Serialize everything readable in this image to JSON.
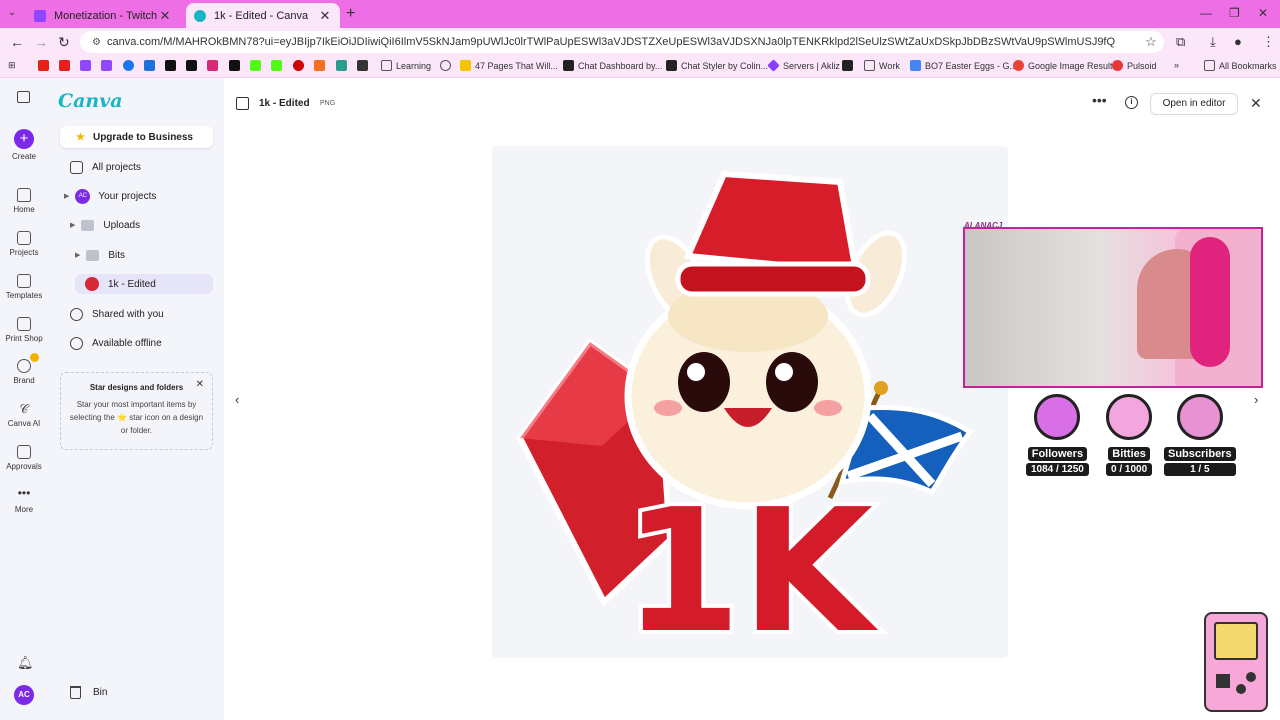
{
  "browser": {
    "tabs": [
      {
        "label": "Monetization - Twitch",
        "close": "✕",
        "icon_color": "#9146ff"
      },
      {
        "label": "1k - Edited - Canva",
        "close": "✕",
        "icon_color": "#17b5c6"
      }
    ],
    "url": "canva.com/M/MAHROkBMN78?ui=eyJBIjp7IkEiOiJDIiwiQiI6IlmV5SkNJam9pUWlJc0lrTWlPaUpESWl3aVJDSTZXeUpESWl3aVJDSXNJa0lpTENKRklpd2lSeUlzSWtZaUxDSkpJbDBzSWtVaU9pSWlmUSJ9fQ",
    "bookmarks": [
      "Learning",
      "47 Pages That Will...",
      "Chat Dashboard by...",
      "Chat Styler by Colin...",
      "Servers | Akliz",
      "Work",
      "BO7 Easter Eggs - G...",
      "Google Image Result",
      "Pulsoid",
      "All Bookmarks"
    ]
  },
  "rail": {
    "create": "Create",
    "home": "Home",
    "projects": "Projects",
    "templates": "Templates",
    "print_shop": "Print Shop",
    "brand": "Brand",
    "canva_ai": "Canva AI",
    "approvals": "Approvals",
    "more": "More",
    "avatar": "AC"
  },
  "panel": {
    "logo": "Canva",
    "upgrade": "Upgrade to Business",
    "all_projects": "All projects",
    "your_projects": "Your projects",
    "uploads": "Uploads",
    "bits": "Bits",
    "current": "1k - Edited",
    "shared": "Shared with you",
    "offline": "Available offline",
    "star_card": {
      "title": "Star designs and folders",
      "body": "Star your most important items by selecting the ⭐ star icon on a design or folder."
    },
    "bin": "Bin"
  },
  "viewer": {
    "title": "1k - Edited",
    "format": "PNG",
    "open_editor": "Open in editor",
    "artwork_text": "1K"
  },
  "overlay": {
    "cam_label": "ALANACJ",
    "stats": [
      {
        "label": "Followers",
        "value": "1084 / 1250"
      },
      {
        "label": "Bitties",
        "value": "0 / 1000"
      },
      {
        "label": "Subscribers",
        "value": "1 / 5"
      }
    ]
  }
}
